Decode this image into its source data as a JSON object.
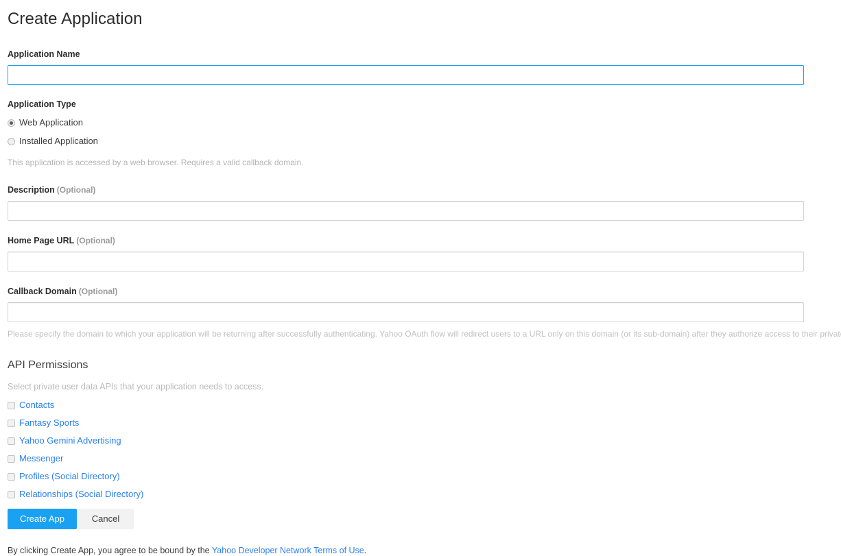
{
  "page": {
    "title": "Create Application"
  },
  "colors": {
    "link": "#2a7ff0",
    "primary_button": "#1ba1f2",
    "focus_border": "#18a0f0",
    "muted_text": "#b9b9b9"
  },
  "fields": {
    "app_name": {
      "label": "Application Name",
      "value": "",
      "placeholder": ""
    },
    "app_type": {
      "label": "Application Type",
      "options": [
        {
          "label": "Web Application",
          "checked": true
        },
        {
          "label": "Installed Application",
          "checked": false
        }
      ],
      "help": "This application is accessed by a web browser. Requires a valid callback domain."
    },
    "description": {
      "label": "Description",
      "optional_tag": "(Optional)",
      "value": "",
      "placeholder": ""
    },
    "home_page_url": {
      "label": "Home Page URL",
      "optional_tag": "(Optional)",
      "value": "",
      "placeholder": ""
    },
    "callback_domain": {
      "label": "Callback Domain",
      "optional_tag": "(Optional)",
      "value": "",
      "placeholder": "",
      "help": "Please specify the domain to which your application will be returning after successfully authenticating. Yahoo OAuth flow will redirect users to a URL only on this domain (or its sub-domain) after they authorize access to their private data."
    }
  },
  "api_permissions": {
    "heading": "API Permissions",
    "subtitle": "Select private user data APIs that your application needs to access.",
    "items": [
      {
        "label": "Contacts",
        "checked": false
      },
      {
        "label": "Fantasy Sports",
        "checked": false
      },
      {
        "label": "Yahoo Gemini Advertising",
        "checked": false
      },
      {
        "label": "Messenger",
        "checked": false
      },
      {
        "label": "Profiles (Social Directory)",
        "checked": false
      },
      {
        "label": "Relationships (Social Directory)",
        "checked": false
      }
    ]
  },
  "actions": {
    "create_label": "Create App",
    "cancel_label": "Cancel"
  },
  "footer": {
    "text_before": "By clicking Create App, you agree to be bound by the ",
    "link_text": "Yahoo Developer Network Terms of Use",
    "text_after": "."
  }
}
